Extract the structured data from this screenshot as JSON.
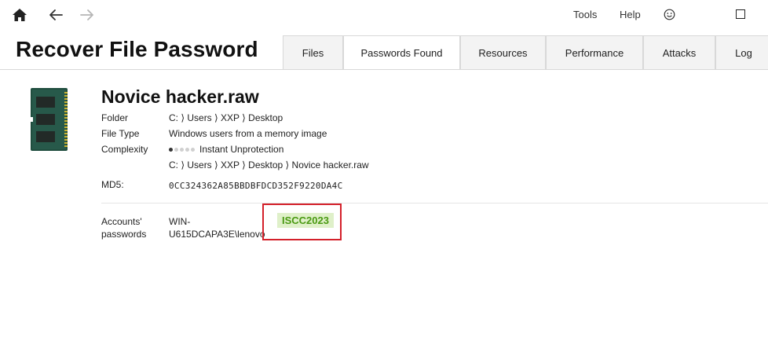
{
  "nav": {
    "home_icon": "home-icon",
    "back_icon": "arrow-left-icon",
    "forward_icon": "arrow-right-icon",
    "tools_label": "Tools",
    "help_label": "Help",
    "feedback_icon": "smiley-icon",
    "maximize_icon": "maximize-icon"
  },
  "app": {
    "title": "Recover File Password"
  },
  "tabs": [
    {
      "label": "Files",
      "active": false
    },
    {
      "label": "Passwords Found",
      "active": true
    },
    {
      "label": "Resources",
      "active": false
    },
    {
      "label": "Performance",
      "active": false
    },
    {
      "label": "Attacks",
      "active": false
    },
    {
      "label": "Log",
      "active": false
    }
  ],
  "file": {
    "icon": "memory-module-icon",
    "name": "Novice hacker.raw",
    "folder_label": "Folder",
    "folder_value": "C: ⟩ Users ⟩ XXP ⟩ Desktop",
    "type_label": "File Type",
    "type_value": "Windows users from a memory image",
    "complexity_label": "Complexity",
    "complexity_level": 1,
    "complexity_max": 5,
    "complexity_value": "Instant Unprotection",
    "path_value": "C: ⟩ Users ⟩ XXP ⟩ Desktop ⟩ Novice hacker.raw",
    "md5_label": "MD5:",
    "md5_value": "0CC324362A85BBDBFDCD352F9220DA4C"
  },
  "results": {
    "accounts_label_line1": "Accounts'",
    "accounts_label_line2": "passwords",
    "account_line1": "WIN-",
    "account_line2": "U615DCAPA3E\\lenovo",
    "password": "ISCC2023",
    "highlight_color": "#d4202a"
  }
}
